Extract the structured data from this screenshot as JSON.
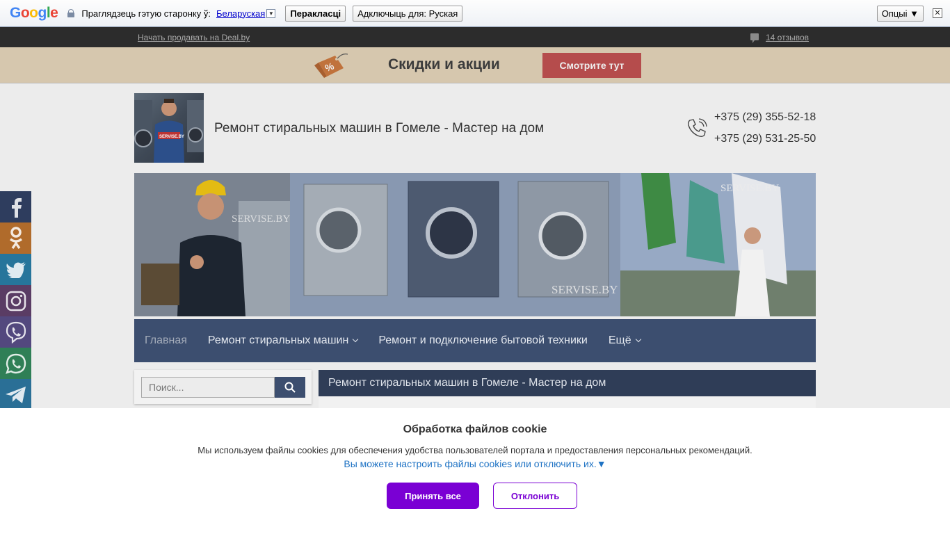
{
  "google_bar": {
    "logo": [
      "G",
      "o",
      "o",
      "g",
      "l",
      "e"
    ],
    "prompt": "Праглядзець гэтую старонку ў:",
    "language": "Беларуская",
    "translate_button": "Перакласці",
    "disable_button": "Адключыць для: Руская",
    "options_button": "Опцыі ▼",
    "close_glyph": "✕"
  },
  "top_strip": {
    "sell_link": "Начать продавать на Deal.by",
    "reviews_link": "14 отзывов"
  },
  "promo": {
    "title": "Скидки и акции",
    "cta": "Смотрите тут",
    "tag_symbol": "%"
  },
  "header": {
    "logo_watermark": "SERVISE.BY",
    "site_title": "Ремонт стиральных машин в Гомеле - Мастер на дом",
    "phones": [
      "+375 (29) 355-52-18",
      "+375 (29) 531-25-50"
    ]
  },
  "hero": {
    "watermarks": [
      "SERVISE.BY",
      "SERVISE.BY",
      "SERVISE.BY"
    ]
  },
  "nav": {
    "items": [
      {
        "label": "Главная"
      },
      {
        "label": "Ремонт стиральных машин"
      },
      {
        "label": "Ремонт и подключение бытовой техники"
      },
      {
        "label": "Ещё"
      }
    ]
  },
  "search": {
    "placeholder": "Поиск..."
  },
  "content": {
    "heading": "Ремонт стиральных машин в Гомеле - Мастер на дом"
  },
  "social": [
    "facebook-icon",
    "odnoklassniki-icon",
    "twitter-icon",
    "instagram-icon",
    "viber-icon",
    "whatsapp-icon",
    "telegram-icon"
  ],
  "cookie": {
    "title": "Обработка файлов cookie",
    "text": "Мы используем файлы cookies для обеспечения удобства пользователей портала и предоставления персональных рекомендаций.",
    "link": "Вы можете настроить файлы cookies или отключить их.▼",
    "accept": "Принять все",
    "decline": "Отклонить"
  },
  "colors": {
    "nav_bg": "#3c4e6f",
    "accept_bg": "#7a00d4",
    "promo_cta": "#b54c4c"
  }
}
